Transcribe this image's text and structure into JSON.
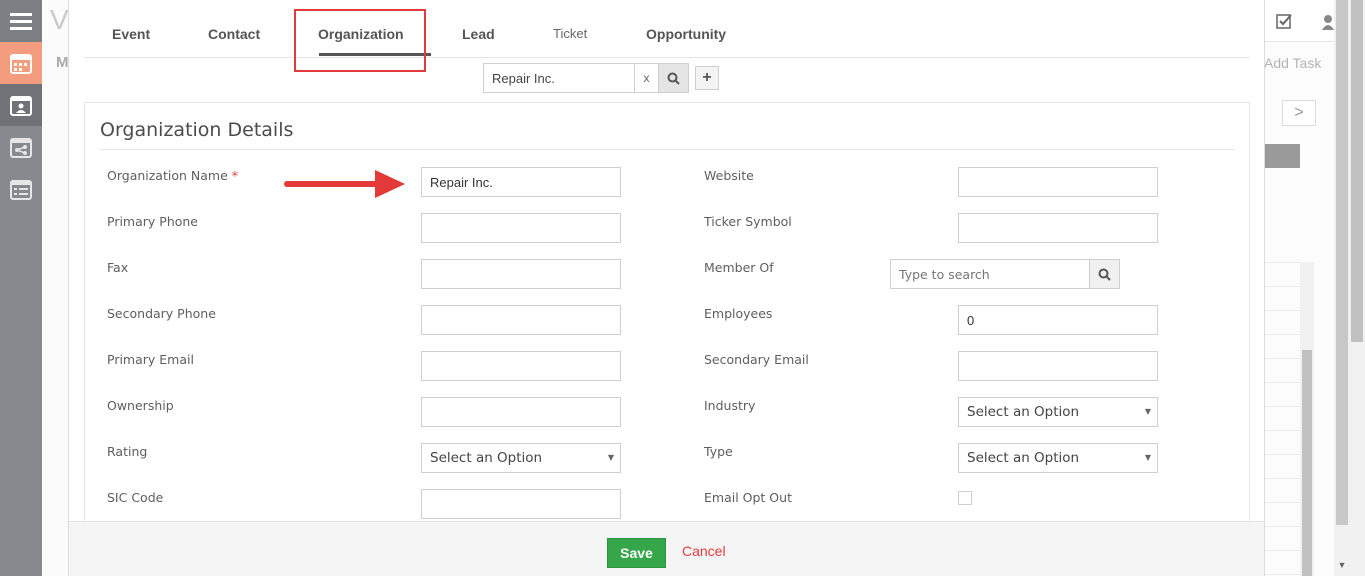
{
  "background": {
    "title_fragment": "V",
    "section_fragment": "M",
    "add_task_label": "Add Task",
    "nav_next": ">"
  },
  "tabs": [
    {
      "label": "Event"
    },
    {
      "label": "Contact"
    },
    {
      "label": "Organization",
      "active": true
    },
    {
      "label": "Lead"
    },
    {
      "label": "Ticket"
    },
    {
      "label": "Opportunity"
    }
  ],
  "search": {
    "value": "Repair Inc.",
    "clear_label": "x",
    "add_label": "+"
  },
  "panel": {
    "title": "Organization Details"
  },
  "fields": {
    "organization_name": {
      "label": "Organization Name",
      "required_mark": "*",
      "value": "Repair Inc."
    },
    "primary_phone": {
      "label": "Primary Phone",
      "value": ""
    },
    "fax": {
      "label": "Fax",
      "value": ""
    },
    "secondary_phone": {
      "label": "Secondary Phone",
      "value": ""
    },
    "primary_email": {
      "label": "Primary Email",
      "value": ""
    },
    "ownership": {
      "label": "Ownership",
      "value": ""
    },
    "rating": {
      "label": "Rating",
      "value": "Select an Option"
    },
    "sic_code": {
      "label": "SIC Code",
      "value": ""
    },
    "website": {
      "label": "Website",
      "value": ""
    },
    "ticker_symbol": {
      "label": "Ticker Symbol",
      "value": ""
    },
    "member_of": {
      "label": "Member Of",
      "placeholder": "Type to search"
    },
    "employees": {
      "label": "Employees",
      "value": "0"
    },
    "secondary_email": {
      "label": "Secondary Email",
      "value": ""
    },
    "industry": {
      "label": "Industry",
      "value": "Select an Option"
    },
    "type": {
      "label": "Type",
      "value": "Select an Option"
    },
    "email_opt_out": {
      "label": "Email Opt Out",
      "checked": false
    }
  },
  "footer": {
    "save_label": "Save",
    "cancel_label": "Cancel"
  },
  "colors": {
    "save_green": "#35a64a",
    "cancel_red": "#e13c3c",
    "highlight_red": "#e4393b",
    "sidebar_accent": "#f39c7e"
  }
}
